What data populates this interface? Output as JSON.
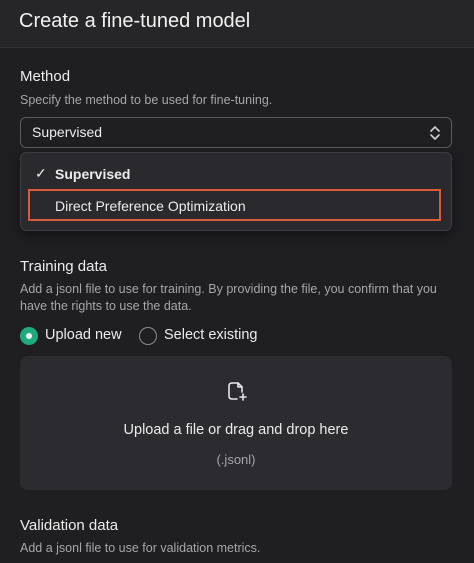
{
  "header": {
    "title": "Create a fine-tuned model"
  },
  "method": {
    "label": "Method",
    "description": "Specify the method to be used for fine-tuning.",
    "selected": "Supervised",
    "options": [
      {
        "label": "Supervised",
        "checked": true
      },
      {
        "label": "Direct Preference Optimization",
        "checked": false
      }
    ]
  },
  "training": {
    "label": "Training data",
    "description": "Add a jsonl file to use for training. By providing the file, you confirm that you have the rights to use the data.",
    "radios": [
      {
        "label": "Upload new",
        "selected": true
      },
      {
        "label": "Select existing",
        "selected": false
      }
    ],
    "dropzone": {
      "main_text": "Upload a file or drag and drop here",
      "sub_text": "(.jsonl)"
    }
  },
  "validation": {
    "label": "Validation data",
    "description": "Add a jsonl file to use for validation metrics."
  },
  "icons": {
    "check": "✓",
    "caret": "chevron-up-down-icon",
    "upload": "file-plus-icon"
  },
  "colors": {
    "accent": "#1fa97f",
    "highlight": "#d9593b"
  }
}
